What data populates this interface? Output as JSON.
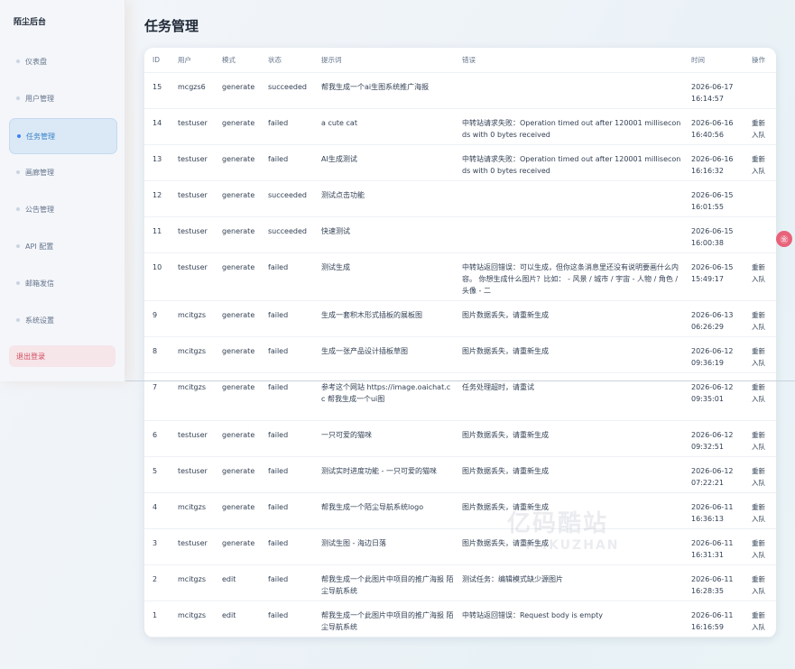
{
  "app": {
    "title": "陌尘后台"
  },
  "page": {
    "title": "任务管理"
  },
  "sidebar": {
    "items": [
      {
        "label": "仪表盘"
      },
      {
        "label": "用户管理"
      },
      {
        "label": "任务管理"
      },
      {
        "label": "画廊管理"
      },
      {
        "label": "公告管理"
      },
      {
        "label": "API 配置"
      },
      {
        "label": "邮箱发信"
      },
      {
        "label": "系统设置"
      }
    ],
    "logout": "退出登录"
  },
  "table": {
    "columns": [
      "ID",
      "用户",
      "模式",
      "状态",
      "提示词",
      "错误",
      "时间",
      "操作"
    ],
    "action_label": "重新入队",
    "rows": [
      {
        "id": "15",
        "user": "mcgzs6",
        "mode": "generate",
        "status": "succeeded",
        "prompt": "帮我生成一个ai生图系统推广海报",
        "error": "",
        "date": "2026-06-17",
        "time": "16:14:57",
        "action": false
      },
      {
        "id": "14",
        "user": "testuser",
        "mode": "generate",
        "status": "failed",
        "prompt": "a cute cat",
        "error": "中转站请求失败：Operation timed out after 120001 milliseconds with 0 bytes received",
        "date": "2026-06-16",
        "time": "16:40:56",
        "action": true
      },
      {
        "id": "13",
        "user": "testuser",
        "mode": "generate",
        "status": "failed",
        "prompt": "AI生成测试",
        "error": "中转站请求失败：Operation timed out after 120001 milliseconds with 0 bytes received",
        "date": "2026-06-16",
        "time": "16:16:32",
        "action": true
      },
      {
        "id": "12",
        "user": "testuser",
        "mode": "generate",
        "status": "succeeded",
        "prompt": "测试点击功能",
        "error": "",
        "date": "2026-06-15",
        "time": "16:01:55",
        "action": false
      },
      {
        "id": "11",
        "user": "testuser",
        "mode": "generate",
        "status": "succeeded",
        "prompt": "快速测试",
        "error": "",
        "date": "2026-06-15",
        "time": "16:00:38",
        "action": false
      },
      {
        "id": "10",
        "user": "testuser",
        "mode": "generate",
        "status": "failed",
        "prompt": "测试生成",
        "error": "中转站返回错误：可以生成，但你这条消息里还没有说明要画什么内容。 你想生成什么图片？比如： - 风景 / 城市 / 宇宙 - 人物 / 角色 / 头像 - 二",
        "date": "2026-06-15",
        "time": "15:49:17",
        "action": true
      },
      {
        "id": "9",
        "user": "mcitgzs",
        "mode": "generate",
        "status": "failed",
        "prompt": "生成一套积木形式插板的展板图",
        "error": "图片数据丢失，请重新生成",
        "date": "2026-06-13",
        "time": "06:26:29",
        "action": true
      },
      {
        "id": "8",
        "user": "mcitgzs",
        "mode": "generate",
        "status": "failed",
        "prompt": "生成一张产品设计插板草图",
        "error": "图片数据丢失，请重新生成",
        "date": "2026-06-12",
        "time": "09:36:19",
        "action": true
      },
      {
        "id": "7",
        "user": "mcitgzs",
        "mode": "generate",
        "status": "failed",
        "prompt": "参考这个网站 https://image.oaichat.cc 帮我生成一个ui图",
        "error": "任务处理超时，请重试",
        "date": "2026-06-12",
        "time": "09:35:01",
        "action": true
      },
      {
        "id": "6",
        "user": "testuser",
        "mode": "generate",
        "status": "failed",
        "prompt": "一只可爱的猫咪",
        "error": "图片数据丢失，请重新生成",
        "date": "2026-06-12",
        "time": "09:32:51",
        "action": true
      },
      {
        "id": "5",
        "user": "testuser",
        "mode": "generate",
        "status": "failed",
        "prompt": "测试实时进度功能 - 一只可爱的猫咪",
        "error": "图片数据丢失，请重新生成",
        "date": "2026-06-12",
        "time": "07:22:21",
        "action": true
      },
      {
        "id": "4",
        "user": "mcitgzs",
        "mode": "generate",
        "status": "failed",
        "prompt": "帮我生成一个陌尘导航系统logo",
        "error": "图片数据丢失，请重新生成",
        "date": "2026-06-11",
        "time": "16:36:13",
        "action": true
      },
      {
        "id": "3",
        "user": "testuser",
        "mode": "generate",
        "status": "failed",
        "prompt": "测试生图 - 海边日落",
        "error": "图片数据丢失，请重新生成",
        "date": "2026-06-11",
        "time": "16:31:31",
        "action": true
      },
      {
        "id": "2",
        "user": "mcitgzs",
        "mode": "edit",
        "status": "failed",
        "prompt": "帮我生成一个此图片中项目的推广海报 陌尘导航系统",
        "error": "测试任务：编辑模式缺少源图片",
        "date": "2026-06-11",
        "time": "16:28:35",
        "action": true
      },
      {
        "id": "1",
        "user": "mcitgzs",
        "mode": "edit",
        "status": "failed",
        "prompt": "帮我生成一个此图片中项目的推广海报 陌尘导航系统",
        "error": "中转站返回错误：Request body is empty",
        "date": "2026-06-11",
        "time": "16:16:59",
        "action": true
      }
    ]
  },
  "watermark": {
    "line1": "亿码酷站",
    "line2": "YMKUZHAN"
  },
  "float_button": {
    "label": "㊎"
  }
}
